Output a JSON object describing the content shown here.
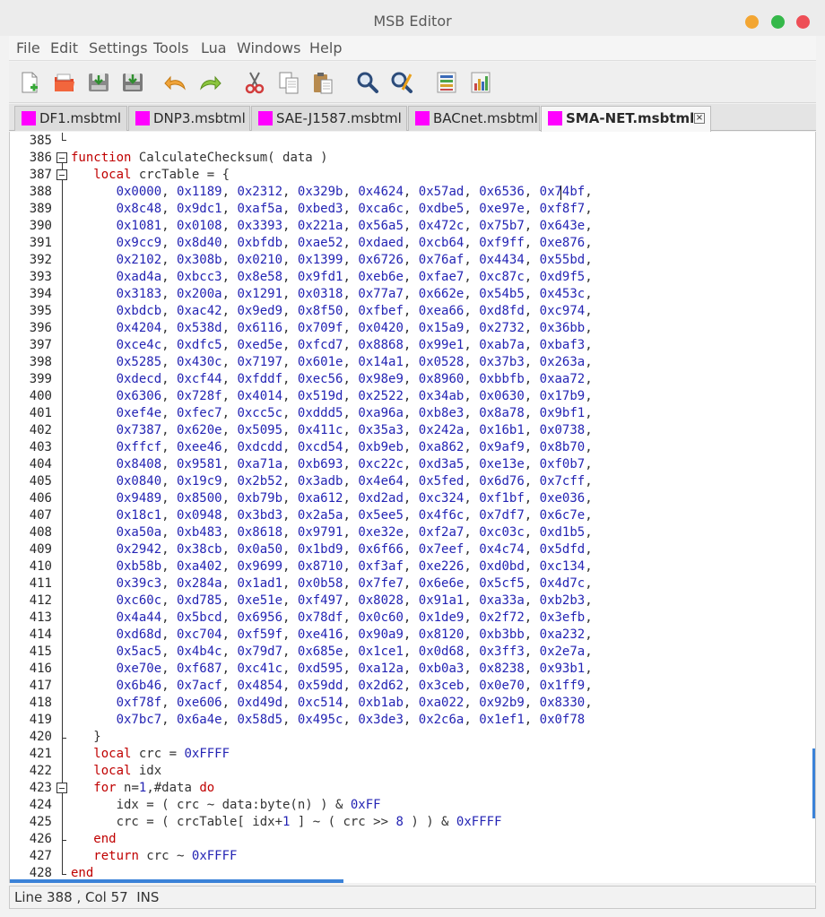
{
  "window": {
    "title": "MSB Editor"
  },
  "menu": [
    "File",
    "Edit",
    "Settings",
    "Tools",
    "Lua",
    "Windows",
    "Help"
  ],
  "toolbar": {
    "buttons": [
      "new-file",
      "open-file",
      "save-file",
      "save-all",
      "undo",
      "redo",
      "cut",
      "copy",
      "paste",
      "find",
      "find-replace",
      "list-view",
      "chart-view"
    ]
  },
  "tabs": [
    {
      "label": "DF1.msbtml",
      "active": false
    },
    {
      "label": "DNP3.msbtml",
      "active": false
    },
    {
      "label": "SAE-J1587.msbtml",
      "active": false
    },
    {
      "label": "BACnet.msbtml",
      "active": false
    },
    {
      "label": "SMA-NET.msbtml",
      "active": true
    }
  ],
  "colors": {
    "keyword": "#c00000",
    "number": "#2424b4",
    "tab_marker": "#ff00ff",
    "accent": "#3b82d8"
  },
  "editor": {
    "lines": [
      {
        "n": "385",
        "segs": []
      },
      {
        "n": "386",
        "segs": [
          {
            "t": "function",
            "c": "kw"
          },
          {
            "t": " CalculateChecksum( data )",
            "c": ""
          }
        ]
      },
      {
        "n": "387",
        "segs": [
          {
            "t": "   ",
            "c": ""
          },
          {
            "t": "local",
            "c": "kw"
          },
          {
            "t": " crcTable = {",
            "c": ""
          }
        ]
      },
      {
        "n": "388",
        "row": [
          "0x0000",
          "0x1189",
          "0x2312",
          "0x329b",
          "0x4624",
          "0x57ad",
          "0x6536",
          "0x74bf"
        ]
      },
      {
        "n": "389",
        "row": [
          "0x8c48",
          "0x9dc1",
          "0xaf5a",
          "0xbed3",
          "0xca6c",
          "0xdbe5",
          "0xe97e",
          "0xf8f7"
        ]
      },
      {
        "n": "390",
        "row": [
          "0x1081",
          "0x0108",
          "0x3393",
          "0x221a",
          "0x56a5",
          "0x472c",
          "0x75b7",
          "0x643e"
        ]
      },
      {
        "n": "391",
        "row": [
          "0x9cc9",
          "0x8d40",
          "0xbfdb",
          "0xae52",
          "0xdaed",
          "0xcb64",
          "0xf9ff",
          "0xe876"
        ]
      },
      {
        "n": "392",
        "row": [
          "0x2102",
          "0x308b",
          "0x0210",
          "0x1399",
          "0x6726",
          "0x76af",
          "0x4434",
          "0x55bd"
        ]
      },
      {
        "n": "393",
        "row": [
          "0xad4a",
          "0xbcc3",
          "0x8e58",
          "0x9fd1",
          "0xeb6e",
          "0xfae7",
          "0xc87c",
          "0xd9f5"
        ]
      },
      {
        "n": "394",
        "row": [
          "0x3183",
          "0x200a",
          "0x1291",
          "0x0318",
          "0x77a7",
          "0x662e",
          "0x54b5",
          "0x453c"
        ]
      },
      {
        "n": "395",
        "row": [
          "0xbdcb",
          "0xac42",
          "0x9ed9",
          "0x8f50",
          "0xfbef",
          "0xea66",
          "0xd8fd",
          "0xc974"
        ]
      },
      {
        "n": "396",
        "row": [
          "0x4204",
          "0x538d",
          "0x6116",
          "0x709f",
          "0x0420",
          "0x15a9",
          "0x2732",
          "0x36bb"
        ]
      },
      {
        "n": "397",
        "row": [
          "0xce4c",
          "0xdfc5",
          "0xed5e",
          "0xfcd7",
          "0x8868",
          "0x99e1",
          "0xab7a",
          "0xbaf3"
        ]
      },
      {
        "n": "398",
        "row": [
          "0x5285",
          "0x430c",
          "0x7197",
          "0x601e",
          "0x14a1",
          "0x0528",
          "0x37b3",
          "0x263a"
        ]
      },
      {
        "n": "399",
        "row": [
          "0xdecd",
          "0xcf44",
          "0xfddf",
          "0xec56",
          "0x98e9",
          "0x8960",
          "0xbbfb",
          "0xaa72"
        ]
      },
      {
        "n": "400",
        "row": [
          "0x6306",
          "0x728f",
          "0x4014",
          "0x519d",
          "0x2522",
          "0x34ab",
          "0x0630",
          "0x17b9"
        ]
      },
      {
        "n": "401",
        "row": [
          "0xef4e",
          "0xfec7",
          "0xcc5c",
          "0xddd5",
          "0xa96a",
          "0xb8e3",
          "0x8a78",
          "0x9bf1"
        ]
      },
      {
        "n": "402",
        "row": [
          "0x7387",
          "0x620e",
          "0x5095",
          "0x411c",
          "0x35a3",
          "0x242a",
          "0x16b1",
          "0x0738"
        ]
      },
      {
        "n": "403",
        "row": [
          "0xffcf",
          "0xee46",
          "0xdcdd",
          "0xcd54",
          "0xb9eb",
          "0xa862",
          "0x9af9",
          "0x8b70"
        ]
      },
      {
        "n": "404",
        "row": [
          "0x8408",
          "0x9581",
          "0xa71a",
          "0xb693",
          "0xc22c",
          "0xd3a5",
          "0xe13e",
          "0xf0b7"
        ]
      },
      {
        "n": "405",
        "row": [
          "0x0840",
          "0x19c9",
          "0x2b52",
          "0x3adb",
          "0x4e64",
          "0x5fed",
          "0x6d76",
          "0x7cff"
        ]
      },
      {
        "n": "406",
        "row": [
          "0x9489",
          "0x8500",
          "0xb79b",
          "0xa612",
          "0xd2ad",
          "0xc324",
          "0xf1bf",
          "0xe036"
        ]
      },
      {
        "n": "407",
        "row": [
          "0x18c1",
          "0x0948",
          "0x3bd3",
          "0x2a5a",
          "0x5ee5",
          "0x4f6c",
          "0x7df7",
          "0x6c7e"
        ]
      },
      {
        "n": "408",
        "row": [
          "0xa50a",
          "0xb483",
          "0x8618",
          "0x9791",
          "0xe32e",
          "0xf2a7",
          "0xc03c",
          "0xd1b5"
        ]
      },
      {
        "n": "409",
        "row": [
          "0x2942",
          "0x38cb",
          "0x0a50",
          "0x1bd9",
          "0x6f66",
          "0x7eef",
          "0x4c74",
          "0x5dfd"
        ]
      },
      {
        "n": "410",
        "row": [
          "0xb58b",
          "0xa402",
          "0x9699",
          "0x8710",
          "0xf3af",
          "0xe226",
          "0xd0bd",
          "0xc134"
        ]
      },
      {
        "n": "411",
        "row": [
          "0x39c3",
          "0x284a",
          "0x1ad1",
          "0x0b58",
          "0x7fe7",
          "0x6e6e",
          "0x5cf5",
          "0x4d7c"
        ]
      },
      {
        "n": "412",
        "row": [
          "0xc60c",
          "0xd785",
          "0xe51e",
          "0xf497",
          "0x8028",
          "0x91a1",
          "0xa33a",
          "0xb2b3"
        ]
      },
      {
        "n": "413",
        "row": [
          "0x4a44",
          "0x5bcd",
          "0x6956",
          "0x78df",
          "0x0c60",
          "0x1de9",
          "0x2f72",
          "0x3efb"
        ]
      },
      {
        "n": "414",
        "row": [
          "0xd68d",
          "0xc704",
          "0xf59f",
          "0xe416",
          "0x90a9",
          "0x8120",
          "0xb3bb",
          "0xa232"
        ]
      },
      {
        "n": "415",
        "row": [
          "0x5ac5",
          "0x4b4c",
          "0x79d7",
          "0x685e",
          "0x1ce1",
          "0x0d68",
          "0x3ff3",
          "0x2e7a"
        ]
      },
      {
        "n": "416",
        "row": [
          "0xe70e",
          "0xf687",
          "0xc41c",
          "0xd595",
          "0xa12a",
          "0xb0a3",
          "0x8238",
          "0x93b1"
        ]
      },
      {
        "n": "417",
        "row": [
          "0x6b46",
          "0x7acf",
          "0x4854",
          "0x59dd",
          "0x2d62",
          "0x3ceb",
          "0x0e70",
          "0x1ff9"
        ]
      },
      {
        "n": "418",
        "row": [
          "0xf78f",
          "0xe606",
          "0xd49d",
          "0xc514",
          "0xb1ab",
          "0xa022",
          "0x92b9",
          "0x8330"
        ]
      },
      {
        "n": "419",
        "row": [
          "0x7bc7",
          "0x6a4e",
          "0x58d5",
          "0x495c",
          "0x3de3",
          "0x2c6a",
          "0x1ef1",
          "0x0f78"
        ],
        "last": true
      },
      {
        "n": "420",
        "segs": [
          {
            "t": "   }",
            "c": ""
          }
        ]
      },
      {
        "n": "421",
        "segs": [
          {
            "t": "   ",
            "c": ""
          },
          {
            "t": "local",
            "c": "kw"
          },
          {
            "t": " crc = ",
            "c": ""
          },
          {
            "t": "0xFFFF",
            "c": "num"
          }
        ]
      },
      {
        "n": "422",
        "segs": [
          {
            "t": "   ",
            "c": ""
          },
          {
            "t": "local",
            "c": "kw"
          },
          {
            "t": " idx",
            "c": ""
          }
        ]
      },
      {
        "n": "423",
        "segs": [
          {
            "t": "   ",
            "c": ""
          },
          {
            "t": "for",
            "c": "kw"
          },
          {
            "t": " n=",
            "c": ""
          },
          {
            "t": "1",
            "c": "num"
          },
          {
            "t": ",#data ",
            "c": ""
          },
          {
            "t": "do",
            "c": "kw"
          }
        ]
      },
      {
        "n": "424",
        "segs": [
          {
            "t": "      idx = ( crc ~ data:byte(n) ) & ",
            "c": ""
          },
          {
            "t": "0xFF",
            "c": "num"
          }
        ]
      },
      {
        "n": "425",
        "segs": [
          {
            "t": "      crc = ( crcTable[ idx+",
            "c": ""
          },
          {
            "t": "1",
            "c": "num"
          },
          {
            "t": " ] ~ ( crc >> ",
            "c": ""
          },
          {
            "t": "8",
            "c": "num"
          },
          {
            "t": " ) ) & ",
            "c": ""
          },
          {
            "t": "0xFFFF",
            "c": "num"
          }
        ]
      },
      {
        "n": "426",
        "segs": [
          {
            "t": "   ",
            "c": ""
          },
          {
            "t": "end",
            "c": "kw"
          }
        ]
      },
      {
        "n": "427",
        "segs": [
          {
            "t": "   ",
            "c": ""
          },
          {
            "t": "return",
            "c": "kw"
          },
          {
            "t": " crc ~ ",
            "c": ""
          },
          {
            "t": "0xFFFF",
            "c": "num"
          }
        ]
      },
      {
        "n": "428",
        "segs": [
          {
            "t": "end",
            "c": "kw"
          }
        ]
      }
    ]
  },
  "status": {
    "line_label": "Line",
    "line": "388",
    "col_label": "Col",
    "col": "57",
    "mode": "INS"
  }
}
